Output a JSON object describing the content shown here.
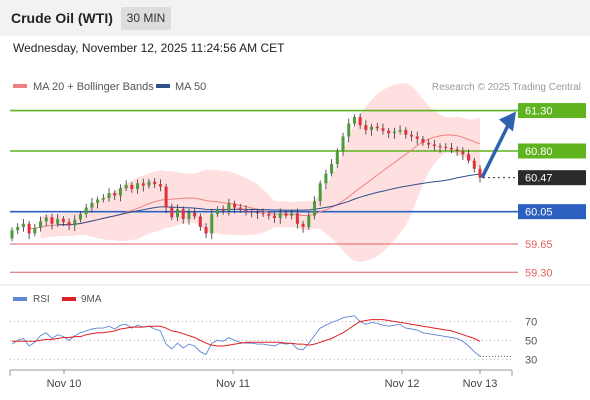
{
  "header": {
    "title": "Crude Oil (WTI)",
    "timeframe": "30 MIN",
    "datetime": "Wednesday, November 12, 2025 11:24:56 AM CET"
  },
  "colors": {
    "resistance": "#5fb31e",
    "support": "#2b5fc0",
    "minor": "#e06060",
    "price_tag": "#2a2a2a",
    "bollinger_fill": "#ffd5d5",
    "ma20": "#f08080",
    "ma50": "#2f4f8f",
    "candle_up": "#4c9a3c",
    "candle_down": "#e0303c",
    "rsi": "#5f86d8",
    "rsi_ma": "#e02020",
    "arrow": "#2e62b0"
  },
  "chart_data": {
    "type": "line",
    "legend": [
      {
        "label": "MA 20 + Bollinger Bands",
        "color": "#f08080"
      },
      {
        "label": "MA 50",
        "color": "#2f4f8f"
      }
    ],
    "watermark": "Research © 2025 Trading Central",
    "y_range": [
      59.18,
      61.48
    ],
    "levels": [
      {
        "value": "61.30",
        "kind": "resistance"
      },
      {
        "value": "60.80",
        "kind": "resistance"
      },
      {
        "value": "60.47",
        "kind": "last"
      },
      {
        "value": "60.05",
        "kind": "support"
      },
      {
        "value": "59.65",
        "kind": "minor"
      },
      {
        "value": "59.30",
        "kind": "minor"
      }
    ],
    "x_labels": [
      "Nov 10",
      "Nov 11",
      "Nov 12",
      "Nov 13"
    ],
    "price_close": [
      59.82,
      59.86,
      59.9,
      59.78,
      59.85,
      59.93,
      59.98,
      59.9,
      59.96,
      59.92,
      59.88,
      59.95,
      60.02,
      60.1,
      60.16,
      60.2,
      60.22,
      60.28,
      60.25,
      60.34,
      60.38,
      60.33,
      60.4,
      60.37,
      60.42,
      60.39,
      60.36,
      60.1,
      59.98,
      60.08,
      59.96,
      60.04,
      59.99,
      59.86,
      59.78,
      60.02,
      60.08,
      60.06,
      60.15,
      60.1,
      60.07,
      60.05,
      60.04,
      60.03,
      60.02,
      60.0,
      59.97,
      60.03,
      60.0,
      60.03,
      59.9,
      59.86,
      60.0,
      60.18,
      60.4,
      60.52,
      60.64,
      60.8,
      60.98,
      61.14,
      61.22,
      61.12,
      61.06,
      61.1,
      61.08,
      61.05,
      61.02,
      61.04,
      61.06,
      61.0,
      60.98,
      60.95,
      60.9,
      60.88,
      60.86,
      60.85,
      60.84,
      60.82,
      60.8,
      60.76,
      60.68,
      60.58,
      60.47
    ],
    "price_open": [
      59.72,
      59.82,
      59.86,
      59.9,
      59.78,
      59.85,
      59.93,
      59.98,
      59.9,
      59.96,
      59.92,
      59.88,
      59.95,
      60.02,
      60.1,
      60.16,
      60.2,
      60.22,
      60.28,
      60.25,
      60.34,
      60.38,
      60.33,
      60.4,
      60.37,
      60.42,
      60.39,
      60.36,
      60.1,
      59.98,
      60.08,
      59.96,
      60.04,
      59.99,
      59.86,
      59.78,
      60.02,
      60.08,
      60.06,
      60.15,
      60.1,
      60.07,
      60.05,
      60.04,
      60.03,
      60.02,
      60.0,
      59.97,
      60.03,
      60.0,
      60.03,
      59.9,
      59.86,
      60.0,
      60.18,
      60.4,
      60.52,
      60.64,
      60.8,
      60.98,
      61.14,
      61.22,
      61.12,
      61.06,
      61.1,
      61.08,
      61.05,
      61.02,
      61.04,
      61.06,
      61.0,
      60.98,
      60.95,
      60.9,
      60.88,
      60.86,
      60.85,
      60.84,
      60.82,
      60.8,
      60.76,
      60.68,
      60.58
    ],
    "forecast_target": 61.3,
    "rsi": {
      "legend": [
        {
          "label": "RSI",
          "color": "#5f86d8"
        },
        {
          "label": "9MA",
          "color": "#e02020"
        }
      ],
      "y_range": [
        25,
        80
      ],
      "ticks": [
        "70",
        "50",
        "30"
      ],
      "rsi_values": [
        46,
        50,
        52,
        44,
        48,
        55,
        58,
        52,
        56,
        54,
        50,
        55,
        58,
        60,
        62,
        63,
        63,
        65,
        62,
        66,
        67,
        63,
        66,
        64,
        65,
        62,
        60,
        46,
        41,
        47,
        42,
        46,
        44,
        38,
        35,
        47,
        50,
        49,
        53,
        50,
        48,
        47,
        47,
        46,
        46,
        45,
        44,
        47,
        46,
        47,
        41,
        40,
        47,
        55,
        63,
        66,
        69,
        71,
        74,
        75,
        76,
        70,
        67,
        69,
        68,
        66,
        65,
        66,
        67,
        63,
        62,
        61,
        58,
        57,
        56,
        55,
        54,
        53,
        52,
        49,
        44,
        38,
        33
      ],
      "ma_values": [
        49,
        49,
        49,
        49,
        49,
        50,
        51,
        51,
        52,
        53,
        53,
        54,
        54,
        56,
        57,
        58,
        58,
        59,
        60,
        62,
        63,
        64,
        64,
        64,
        65,
        65,
        65,
        63,
        60,
        59,
        57,
        55,
        53,
        50,
        47,
        45,
        44,
        44,
        45,
        46,
        47,
        48,
        48,
        48,
        48,
        48,
        48,
        48,
        47,
        47,
        46,
        46,
        45,
        46,
        48,
        50,
        52,
        55,
        58,
        62,
        66,
        70,
        71,
        72,
        72,
        72,
        71,
        70,
        69,
        68,
        67,
        66,
        65,
        64,
        63,
        62,
        61,
        60,
        58,
        56,
        54,
        52,
        49
      ]
    }
  }
}
